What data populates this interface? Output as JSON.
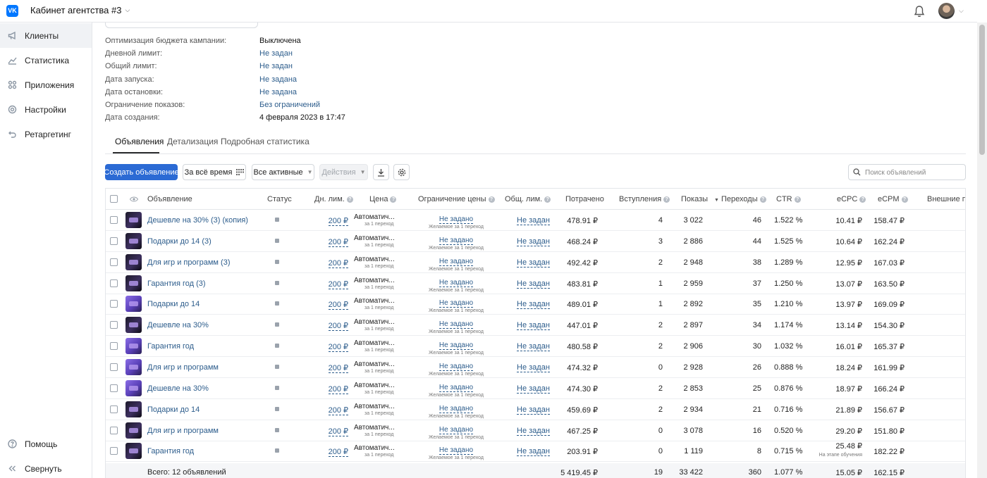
{
  "header": {
    "cabinet_title": "Кабинет агентства #3",
    "logo_text": "VK"
  },
  "sidebar": {
    "items": [
      {
        "label": "Клиенты",
        "icon": "megaphone-icon"
      },
      {
        "label": "Статистика",
        "icon": "chart-icon"
      },
      {
        "label": "Приложения",
        "icon": "apps-icon"
      },
      {
        "label": "Настройки",
        "icon": "gear-icon"
      },
      {
        "label": "Ретаргетинг",
        "icon": "retarget-icon"
      }
    ],
    "help_label": "Помощь",
    "collapse_label": "Свернуть"
  },
  "campaign_info": [
    {
      "key": "Оптимизация бюджета кампании:",
      "value": "Выключена"
    },
    {
      "key": "Дневной лимит:",
      "value": "Не задан"
    },
    {
      "key": "Общий лимит:",
      "value": "Не задан"
    },
    {
      "key": "Дата запуска:",
      "value": "Не задана"
    },
    {
      "key": "Дата остановки:",
      "value": "Не задана"
    },
    {
      "key": "Ограничение показов:",
      "value": "Без ограничений"
    },
    {
      "key": "Дата создания:",
      "value": "4 февраля 2023 в 17:47"
    }
  ],
  "tabs": [
    "Объявления",
    "Детализация",
    "Подробная статистика"
  ],
  "toolbar": {
    "create_label": "Создать объявление",
    "period_label": "За всё время",
    "filter_label": "Все активные",
    "actions_label": "Действия",
    "search_placeholder": "Поиск объявлений"
  },
  "columns": {
    "ad": "Объявление",
    "status": "Статус",
    "daily_limit": "Дн. лим.",
    "price": "Цена",
    "price_limit": "Ограничение цены",
    "total_limit": "Общ. лим.",
    "spent": "Потрачено",
    "joins": "Вступления",
    "shows": "Показы",
    "clicks": "Переходы",
    "ctr": "CTR",
    "ecpc": "eCPC",
    "ecpm": "eCPM",
    "external": "Внешние пер"
  },
  "cell_texts": {
    "daily_limit": "200 ₽",
    "price": "Автоматич...",
    "price_sub": "за 1 переход",
    "price_limit": "Не задано",
    "price_limit_sub": "Желаемое за 1 переход",
    "total_limit": "Не задан",
    "learning_note": "На этапе обучения"
  },
  "rows": [
    {
      "name": "Дешевле на 30% (3) (копия)",
      "spent": "478.91 ₽",
      "joins": "4",
      "shows": "3 022",
      "clicks": "46",
      "ctr": "1.522 %",
      "ecpc": "10.41 ₽",
      "ecpm": "158.47 ₽",
      "thumb": "dark"
    },
    {
      "name": "Подарки до 14 (3)",
      "spent": "468.24 ₽",
      "joins": "3",
      "shows": "2 886",
      "clicks": "44",
      "ctr": "1.525 %",
      "ecpc": "10.64 ₽",
      "ecpm": "162.24 ₽",
      "thumb": "dark"
    },
    {
      "name": "Для игр и программ (3)",
      "spent": "492.42 ₽",
      "joins": "2",
      "shows": "2 948",
      "clicks": "38",
      "ctr": "1.289 %",
      "ecpc": "12.95 ₽",
      "ecpm": "167.03 ₽",
      "thumb": "dark"
    },
    {
      "name": "Гарантия год (3)",
      "spent": "483.81 ₽",
      "joins": "1",
      "shows": "2 959",
      "clicks": "37",
      "ctr": "1.250 %",
      "ecpc": "13.07 ₽",
      "ecpm": "163.50 ₽",
      "thumb": "dark"
    },
    {
      "name": "Подарки до 14",
      "spent": "489.01 ₽",
      "joins": "1",
      "shows": "2 892",
      "clicks": "35",
      "ctr": "1.210 %",
      "ecpc": "13.97 ₽",
      "ecpm": "169.09 ₽",
      "thumb": "purple"
    },
    {
      "name": "Дешевле на 30%",
      "spent": "447.01 ₽",
      "joins": "2",
      "shows": "2 897",
      "clicks": "34",
      "ctr": "1.174 %",
      "ecpc": "13.14 ₽",
      "ecpm": "154.30 ₽",
      "thumb": "dark"
    },
    {
      "name": "Гарантия год",
      "spent": "480.58 ₽",
      "joins": "2",
      "shows": "2 906",
      "clicks": "30",
      "ctr": "1.032 %",
      "ecpc": "16.01 ₽",
      "ecpm": "165.37 ₽",
      "thumb": "purple"
    },
    {
      "name": "Для игр и программ",
      "spent": "474.32 ₽",
      "joins": "0",
      "shows": "2 928",
      "clicks": "26",
      "ctr": "0.888 %",
      "ecpc": "18.24 ₽",
      "ecpm": "161.99 ₽",
      "thumb": "purple"
    },
    {
      "name": "Дешевле на 30%",
      "spent": "474.30 ₽",
      "joins": "2",
      "shows": "2 853",
      "clicks": "25",
      "ctr": "0.876 %",
      "ecpc": "18.97 ₽",
      "ecpm": "166.24 ₽",
      "thumb": "purple"
    },
    {
      "name": "Подарки до 14",
      "spent": "459.69 ₽",
      "joins": "2",
      "shows": "2 934",
      "clicks": "21",
      "ctr": "0.716 %",
      "ecpc": "21.89 ₽",
      "ecpm": "156.67 ₽",
      "thumb": "dark"
    },
    {
      "name": "Для игр и программ",
      "spent": "467.25 ₽",
      "joins": "0",
      "shows": "3 078",
      "clicks": "16",
      "ctr": "0.520 %",
      "ecpc": "29.20 ₽",
      "ecpm": "151.80 ₽",
      "thumb": "dark"
    },
    {
      "name": "Гарантия год",
      "spent": "203.91 ₽",
      "joins": "0",
      "shows": "1 119",
      "clicks": "8",
      "ctr": "0.715 %",
      "ecpc": "25.48 ₽",
      "ecpm": "182.22 ₽",
      "thumb": "dark",
      "learning": true
    }
  ],
  "totals": {
    "label": "Всего: 12 объявлений",
    "spent": "5 419.45 ₽",
    "joins": "19",
    "shows": "33 422",
    "clicks": "360",
    "ctr": "1.077 %",
    "ecpc": "15.05 ₽",
    "ecpm": "162.15 ₽"
  },
  "colors": {
    "primary": "#2b6ad4",
    "link": "#2d5d8c",
    "vk_blue": "#0077ff"
  }
}
